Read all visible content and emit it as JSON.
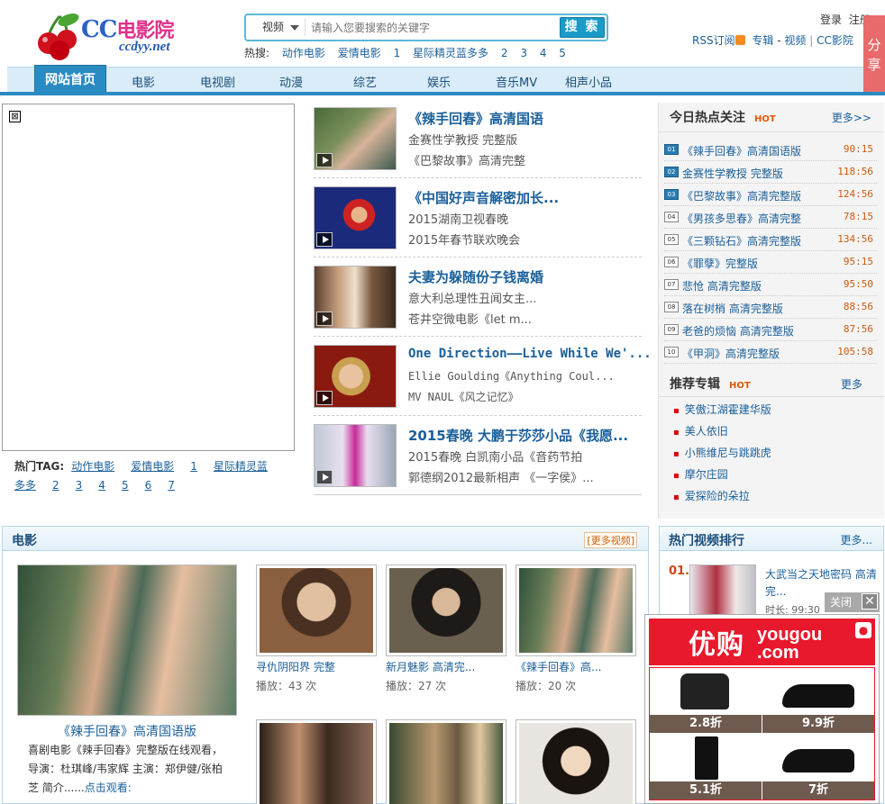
{
  "header": {
    "logo_main": "CC",
    "logo_cn": "电影院",
    "logo_sub": "ccdyy.net",
    "search": {
      "type_label": "视频",
      "placeholder": "请输入您要搜索的关键字",
      "button": "搜 索"
    },
    "hot_search": {
      "label": "热搜:",
      "items": [
        "动作电影",
        "爱情电影",
        "1",
        "星际精灵蓝多多",
        "2",
        "3",
        "4",
        "5"
      ]
    },
    "top_links": [
      "登录",
      "注册"
    ],
    "sub_links": {
      "rss": "RSS订阅",
      "album": "专辑",
      "video": "视频",
      "site": "CC影院",
      "sep1": "-",
      "sep2": "|"
    },
    "share": "分享"
  },
  "nav": {
    "home": "网站首页",
    "items": [
      "电影",
      "电视剧",
      "动漫",
      "综艺",
      "娱乐",
      "音乐MV",
      "相声小品"
    ]
  },
  "hottag": {
    "label": "热门TAG:",
    "items": [
      "动作电影",
      "爱情电影",
      "1",
      "星际精灵蓝",
      "多多",
      "2",
      "3",
      "4",
      "5",
      "6",
      "7"
    ]
  },
  "features": [
    {
      "title": "《辣手回春》高清国语",
      "line1": "金赛性学教授 完整版",
      "line2": "《巴黎故事》高清完整"
    },
    {
      "title": "《中国好声音解密加长...",
      "line1": "2015湖南卫视春晚",
      "line2": "2015年春节联欢晚会"
    },
    {
      "title": "夫妻为躲随份子钱离婚",
      "line1": "意大利总理性丑闻女主...",
      "line2": "苍井空微电影《let m..."
    },
    {
      "title": "One Direction——Live While We'...",
      "line1": "Ellie Goulding《Anything Coul...",
      "line2": "MV NAUL《风之记忆》"
    },
    {
      "title": "2015春晚 大鹏于莎莎小品《我愿...",
      "line1": "2015春晚 白凯南小品《音药节拍",
      "line2": "郭德纲2012最新相声 《一字侯》..."
    }
  ],
  "ranking": {
    "title": "今日热点关注",
    "hot": "HOT",
    "more": "更多>>",
    "items": [
      {
        "num": "01",
        "title": "《辣手回春》高清国语版",
        "time": "90:15"
      },
      {
        "num": "02",
        "title": "金赛性学教授 完整版",
        "time": "118:56"
      },
      {
        "num": "03",
        "title": "《巴黎故事》高清完整版",
        "time": "124:56"
      },
      {
        "num": "04",
        "title": "《男孩多思春》高清完整",
        "time": "78:15"
      },
      {
        "num": "05",
        "title": "《三颗钻石》高清完整版",
        "time": "134:56"
      },
      {
        "num": "06",
        "title": "《罪孽》完整版",
        "time": "95:15"
      },
      {
        "num": "07",
        "title": "悲怆 高清完整版",
        "time": "95:50"
      },
      {
        "num": "08",
        "title": "落在树梢 高清完整版",
        "time": "88:56"
      },
      {
        "num": "09",
        "title": "老爸的烦恼 高清完整版",
        "time": "87:56"
      },
      {
        "num": "10",
        "title": "《甲洞》高清完整版",
        "time": "105:58"
      }
    ]
  },
  "albums": {
    "title": "推荐专辑",
    "hot": "HOT",
    "more": "更多",
    "items": [
      "笑傲江湖霍建华版",
      "美人依旧",
      "小熊维尼与跳跳虎",
      "摩尔庄园",
      "爱探险的朵拉"
    ]
  },
  "movies": {
    "title": "电影",
    "more": "[更多视频]",
    "featured": {
      "title": "《辣手回春》高清国语版",
      "desc": "喜剧电影《辣手回春》完整版在线观看，导演：杜琪峰/韦家辉 主演：郑伊健/张柏芝 简介......",
      "cta": "点击观看:"
    },
    "items": [
      {
        "name": "寻仇阴阳界 完整",
        "plays": "播放：43 次"
      },
      {
        "name": "新月魅影 高清完...",
        "plays": "播放：27 次"
      },
      {
        "name": "《辣手回春》高...",
        "plays": "播放：20 次"
      }
    ]
  },
  "hot_videos": {
    "title": "热门视频排行",
    "more": "更多...",
    "first": {
      "num": "01.",
      "title": "大武当之天地密码 高清完...",
      "duration": "时长: 99:30"
    }
  },
  "ad": {
    "close": "关闭",
    "close_x": "✕",
    "logo_cn": "优购",
    "logo_en1": "yougou",
    "logo_en2": ".com",
    "prices": [
      "2.8折",
      "9.9折",
      "5.1折",
      "7折"
    ]
  }
}
